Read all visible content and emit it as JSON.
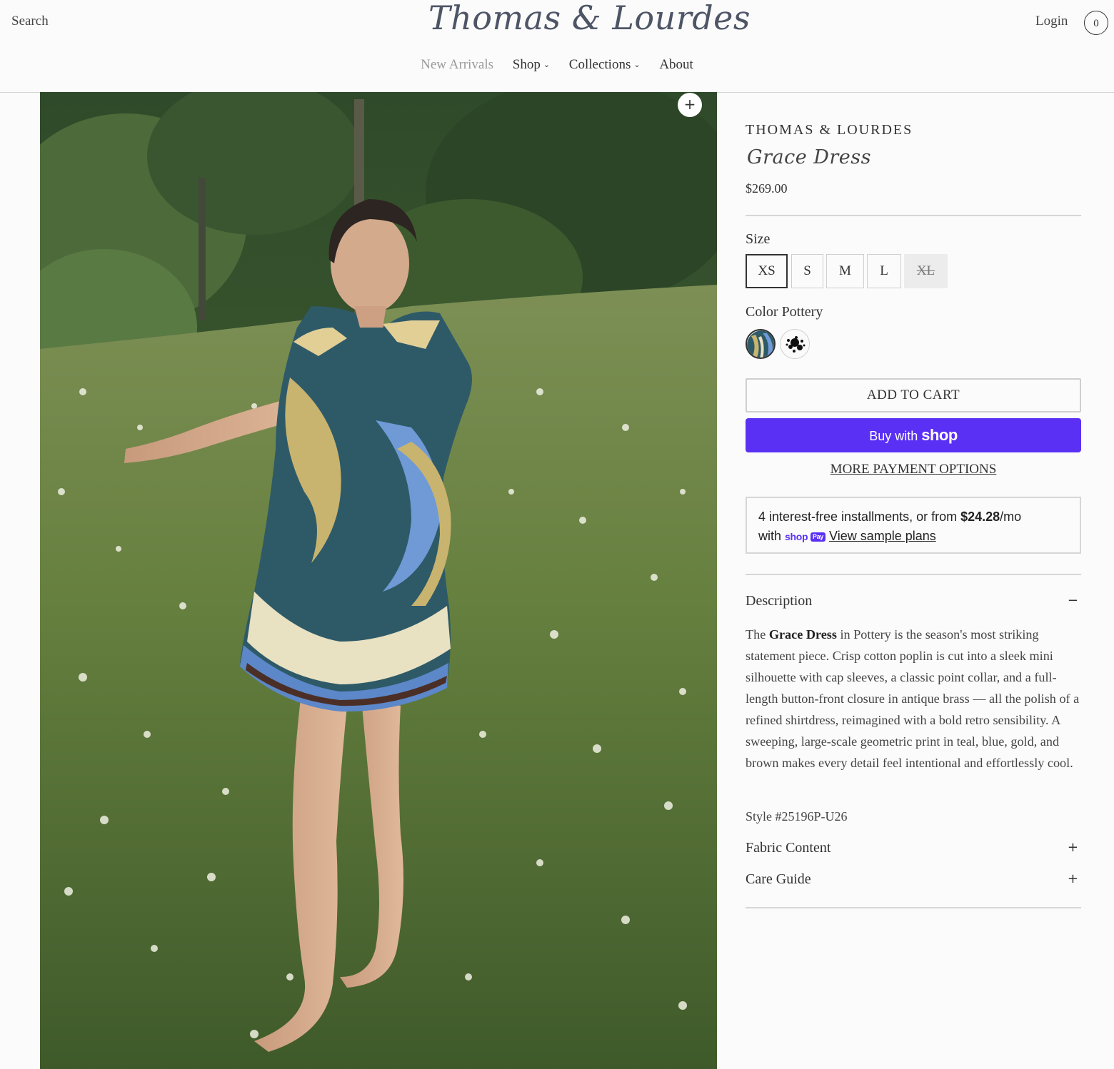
{
  "header": {
    "search_label": "Search",
    "logo_text": "Thomas & Lourdes",
    "login_label": "Login",
    "cart_count": "0",
    "nav": [
      {
        "label": "New Arrivals"
      },
      {
        "label": "Shop"
      },
      {
        "label": "Collections"
      },
      {
        "label": "About"
      }
    ]
  },
  "gallery": {
    "zoom_label": "+"
  },
  "product": {
    "brand": "THOMAS & LOURDES",
    "title": "Grace Dress",
    "price": "$269.00",
    "size_label": "Size",
    "sizes": [
      {
        "label": "XS",
        "state": "selected"
      },
      {
        "label": "S",
        "state": "available"
      },
      {
        "label": "M",
        "state": "available"
      },
      {
        "label": "L",
        "state": "available"
      },
      {
        "label": "XL",
        "state": "sold-out"
      }
    ],
    "color_label": "Color",
    "color_value": "Pottery",
    "add_to_cart": "ADD TO CART",
    "buy_with": "Buy with",
    "buy_brand": "shop",
    "more_payment": "MORE PAYMENT OPTIONS",
    "installments": {
      "prefix": "4 interest-free installments, or from ",
      "amount": "$24.28",
      "suffix": "/mo",
      "with": "with",
      "badge_shop": "shop",
      "badge_pay": "Pay",
      "link": "View sample plans"
    },
    "description": {
      "heading": "Description",
      "toggle": "−",
      "text_before": "The ",
      "text_bold": "Grace Dress",
      "text_after": " in Pottery is the season's most striking statement piece. Crisp cotton poplin is cut into a sleek mini silhouette with cap sleeves, a classic point collar, and a full-length button-front closure in antique brass — all the polish of a refined shirtdress, reimagined with a bold retro sensibility. A sweeping, large-scale geometric print in teal, blue, gold, and brown makes every detail feel intentional and effortlessly cool.",
      "style_no": "Style #25196P-U26"
    },
    "fabric": {
      "heading": "Fabric Content",
      "toggle": "+"
    },
    "care": {
      "heading": "Care Guide",
      "toggle": "+"
    }
  },
  "colors": {
    "accent_shop": "#5a31f4",
    "text": "#333333",
    "border": "#d6d6d6"
  }
}
